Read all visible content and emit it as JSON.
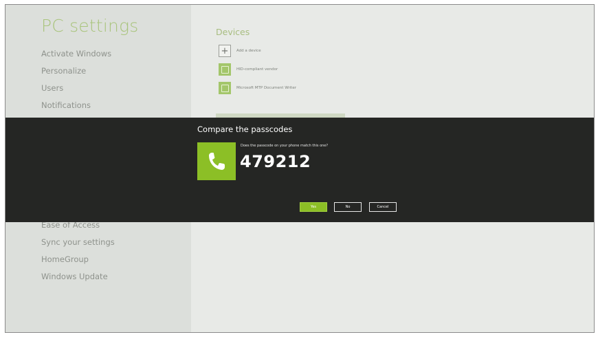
{
  "app": {
    "title": "PC settings"
  },
  "nav": {
    "top_items": [
      "Activate Windows",
      "Personalize",
      "Users",
      "Notifications"
    ],
    "bottom_items": [
      "Ease of Access",
      "Sync your settings",
      "HomeGroup",
      "Windows Update"
    ]
  },
  "devices": {
    "title": "Devices",
    "items": [
      {
        "label": "Add a device",
        "icon": "plus-icon"
      },
      {
        "label": "HID-compliant vendor",
        "icon": "device-icon"
      },
      {
        "label": "Microsoft MTP Document Writer",
        "icon": "printer-icon"
      }
    ]
  },
  "dialog": {
    "title": "Compare the passcodes",
    "question": "Does the passcode on your phone match this one?",
    "passcode": "479212",
    "icon": "phone-icon",
    "yes_label": "Yes",
    "no_label": "No",
    "cancel_label": "Cancel"
  },
  "colors": {
    "accent": "#8cbf26",
    "dialog_bg": "#252624",
    "title": "#a9c47c"
  }
}
